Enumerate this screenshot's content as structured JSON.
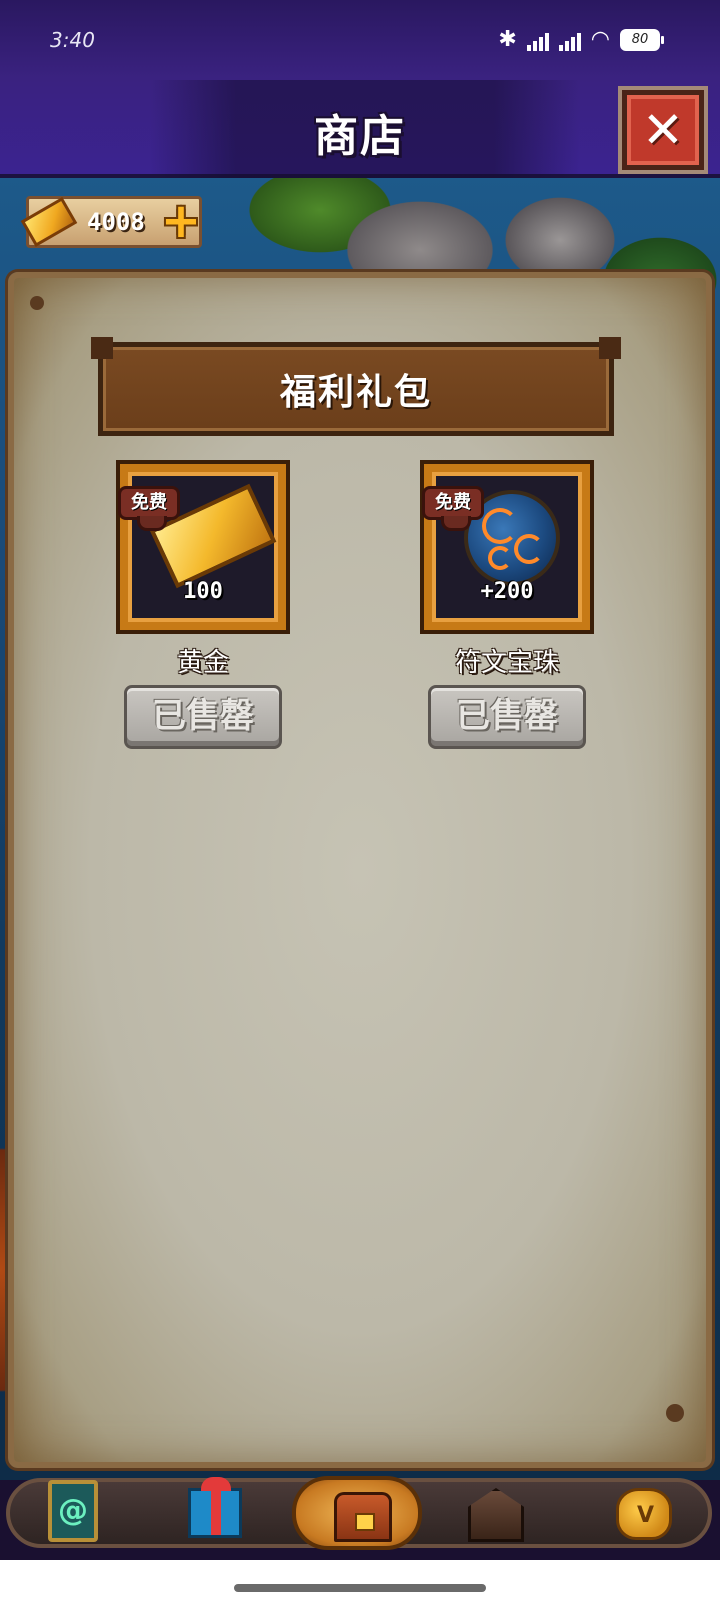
{
  "status_bar": {
    "time": "3:40",
    "battery": "80"
  },
  "header": {
    "title": "商店",
    "close_icon": "close-icon"
  },
  "currency": {
    "gold_icon": "gold-bar-icon",
    "gold_amount": "4008",
    "add_icon": "plus-icon"
  },
  "shop": {
    "section_title": "福利礼包",
    "items": [
      {
        "badge": "免费",
        "icon": "gold-bar-icon",
        "count": "100",
        "name": "黄金",
        "button_label": "已售罄"
      },
      {
        "badge": "免费",
        "icon": "rune-orb-icon",
        "count": "+200",
        "name": "符文宝珠",
        "button_label": "已售罄"
      }
    ]
  },
  "bottom_nav": {
    "items": [
      {
        "icon": "card-icon"
      },
      {
        "icon": "gift-icon"
      },
      {
        "icon": "treasure-chest-icon",
        "active": true
      },
      {
        "icon": "tavern-icon"
      },
      {
        "icon": "money-bag-icon"
      }
    ]
  }
}
